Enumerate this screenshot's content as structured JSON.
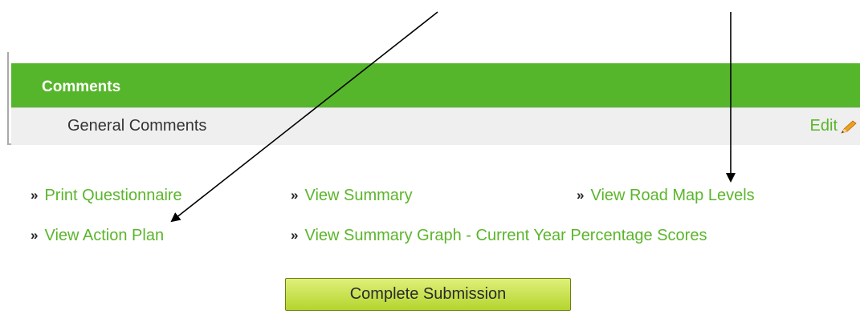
{
  "comments_panel": {
    "header_title": "Comments",
    "row_label": "General Comments",
    "edit_label": "Edit"
  },
  "links": {
    "print_questionnaire": "Print Questionnaire",
    "view_summary": "View Summary",
    "view_road_map_levels": "View Road Map Levels",
    "view_action_plan": "View Action Plan",
    "view_summary_graph": "View Summary Graph - Current Year Percentage Scores"
  },
  "bullet_glyph": "»",
  "complete_button_label": "Complete Submission",
  "colors": {
    "header_green": "#56b62b",
    "link_green": "#5bb52b",
    "button_top": "#dff07a",
    "button_bottom": "#b4d52e"
  }
}
